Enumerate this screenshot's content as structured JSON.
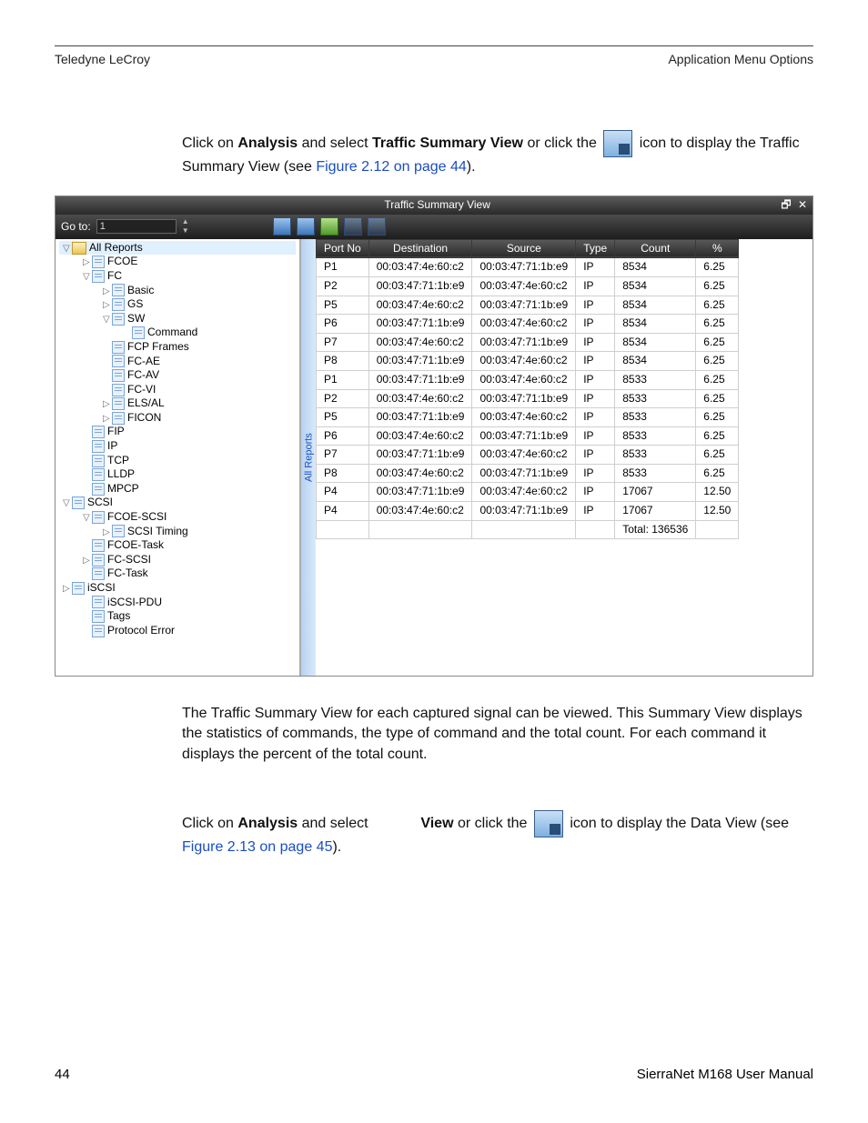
{
  "header": {
    "left": "Teledyne LeCroy",
    "right": "Application Menu Options"
  },
  "intro": {
    "line1_pre": "Click on ",
    "analysis": "Analysis",
    "line1_mid": " and select ",
    "tsv": "Traffic Summary View",
    "line1_post": " or click the ",
    "line1_end": " icon to display the Traffic Summary View (see ",
    "xref1": "Figure 2.12 on page 44",
    "line1_close": ")."
  },
  "window": {
    "title": "Traffic Summary View",
    "goto_label": "Go to:",
    "goto_value": "1",
    "side_tab": "All Reports",
    "tree": [
      {
        "indent": 0,
        "exp": "▽",
        "ic": "folder",
        "label": "All Reports",
        "hl": true
      },
      {
        "indent": 1,
        "exp": "▷",
        "ic": "doc",
        "label": "FCOE"
      },
      {
        "indent": 1,
        "exp": "▽",
        "ic": "doc",
        "label": "FC"
      },
      {
        "indent": 2,
        "exp": "▷",
        "ic": "doc",
        "label": "Basic"
      },
      {
        "indent": 2,
        "exp": "▷",
        "ic": "doc",
        "label": "GS"
      },
      {
        "indent": 2,
        "exp": "▽",
        "ic": "doc",
        "label": "SW"
      },
      {
        "indent": 3,
        "exp": "",
        "ic": "doc",
        "label": "Command"
      },
      {
        "indent": 2,
        "exp": "",
        "ic": "doc",
        "label": "FCP Frames"
      },
      {
        "indent": 2,
        "exp": "",
        "ic": "doc",
        "label": "FC-AE"
      },
      {
        "indent": 2,
        "exp": "",
        "ic": "doc",
        "label": "FC-AV"
      },
      {
        "indent": 2,
        "exp": "",
        "ic": "doc",
        "label": "FC-VI"
      },
      {
        "indent": 2,
        "exp": "▷",
        "ic": "doc",
        "label": "ELS/AL"
      },
      {
        "indent": 2,
        "exp": "▷",
        "ic": "doc",
        "label": "FICON"
      },
      {
        "indent": 1,
        "exp": "",
        "ic": "doc",
        "label": "FIP"
      },
      {
        "indent": 1,
        "exp": "",
        "ic": "doc",
        "label": "IP"
      },
      {
        "indent": 1,
        "exp": "",
        "ic": "doc",
        "label": "TCP"
      },
      {
        "indent": 1,
        "exp": "",
        "ic": "doc",
        "label": "LLDP"
      },
      {
        "indent": 1,
        "exp": "",
        "ic": "doc",
        "label": "MPCP"
      },
      {
        "indent": 0,
        "exp": "▽",
        "ic": "doc",
        "label": "SCSI"
      },
      {
        "indent": 1,
        "exp": "▽",
        "ic": "doc",
        "label": "FCOE-SCSI"
      },
      {
        "indent": 2,
        "exp": "▷",
        "ic": "doc",
        "label": "SCSI Timing"
      },
      {
        "indent": 1,
        "exp": "",
        "ic": "doc",
        "label": "FCOE-Task"
      },
      {
        "indent": 1,
        "exp": "▷",
        "ic": "doc",
        "label": "FC-SCSI"
      },
      {
        "indent": 1,
        "exp": "",
        "ic": "doc",
        "label": "FC-Task"
      },
      {
        "indent": 0,
        "exp": "▷",
        "ic": "doc",
        "label": "iSCSI"
      },
      {
        "indent": 1,
        "exp": "",
        "ic": "doc",
        "label": "iSCSI-PDU"
      },
      {
        "indent": 1,
        "exp": "",
        "ic": "doc",
        "label": "Tags"
      },
      {
        "indent": 1,
        "exp": "",
        "ic": "doc",
        "label": "Protocol Error"
      }
    ],
    "columns": [
      "Port No",
      "Destination",
      "Source",
      "Type",
      "Count",
      "%"
    ],
    "rows": [
      [
        "P1",
        "00:03:47:4e:60:c2",
        "00:03:47:71:1b:e9",
        "IP",
        "8534",
        "6.25"
      ],
      [
        "P2",
        "00:03:47:71:1b:e9",
        "00:03:47:4e:60:c2",
        "IP",
        "8534",
        "6.25"
      ],
      [
        "P5",
        "00:03:47:4e:60:c2",
        "00:03:47:71:1b:e9",
        "IP",
        "8534",
        "6.25"
      ],
      [
        "P6",
        "00:03:47:71:1b:e9",
        "00:03:47:4e:60:c2",
        "IP",
        "8534",
        "6.25"
      ],
      [
        "P7",
        "00:03:47:4e:60:c2",
        "00:03:47:71:1b:e9",
        "IP",
        "8534",
        "6.25"
      ],
      [
        "P8",
        "00:03:47:71:1b:e9",
        "00:03:47:4e:60:c2",
        "IP",
        "8534",
        "6.25"
      ],
      [
        "P1",
        "00:03:47:71:1b:e9",
        "00:03:47:4e:60:c2",
        "IP",
        "8533",
        "6.25"
      ],
      [
        "P2",
        "00:03:47:4e:60:c2",
        "00:03:47:71:1b:e9",
        "IP",
        "8533",
        "6.25"
      ],
      [
        "P5",
        "00:03:47:71:1b:e9",
        "00:03:47:4e:60:c2",
        "IP",
        "8533",
        "6.25"
      ],
      [
        "P6",
        "00:03:47:4e:60:c2",
        "00:03:47:71:1b:e9",
        "IP",
        "8533",
        "6.25"
      ],
      [
        "P7",
        "00:03:47:71:1b:e9",
        "00:03:47:4e:60:c2",
        "IP",
        "8533",
        "6.25"
      ],
      [
        "P8",
        "00:03:47:4e:60:c2",
        "00:03:47:71:1b:e9",
        "IP",
        "8533",
        "6.25"
      ],
      [
        "P4",
        "00:03:47:71:1b:e9",
        "00:03:47:4e:60:c2",
        "IP",
        "17067",
        "12.50"
      ],
      [
        "P4",
        "00:03:47:4e:60:c2",
        "00:03:47:71:1b:e9",
        "IP",
        "17067",
        "12.50"
      ]
    ],
    "total_label": "Total: 136536"
  },
  "para2": "The Traffic Summary View for each captured signal can be viewed. This Summary View displays the statistics of commands, the type of command and the total count. For each command it displays the percent of the total count.",
  "para3": {
    "pre": "Click on ",
    "analysis": "Analysis",
    "mid": " and select             ",
    "view": "View",
    "mid2": " or click the ",
    "post": " icon to display the Data View (see ",
    "xref": "Figure 2.13 on page 45",
    "close": ")."
  },
  "footer": {
    "pageno": "44",
    "manual": "SierraNet M168 User Manual"
  }
}
